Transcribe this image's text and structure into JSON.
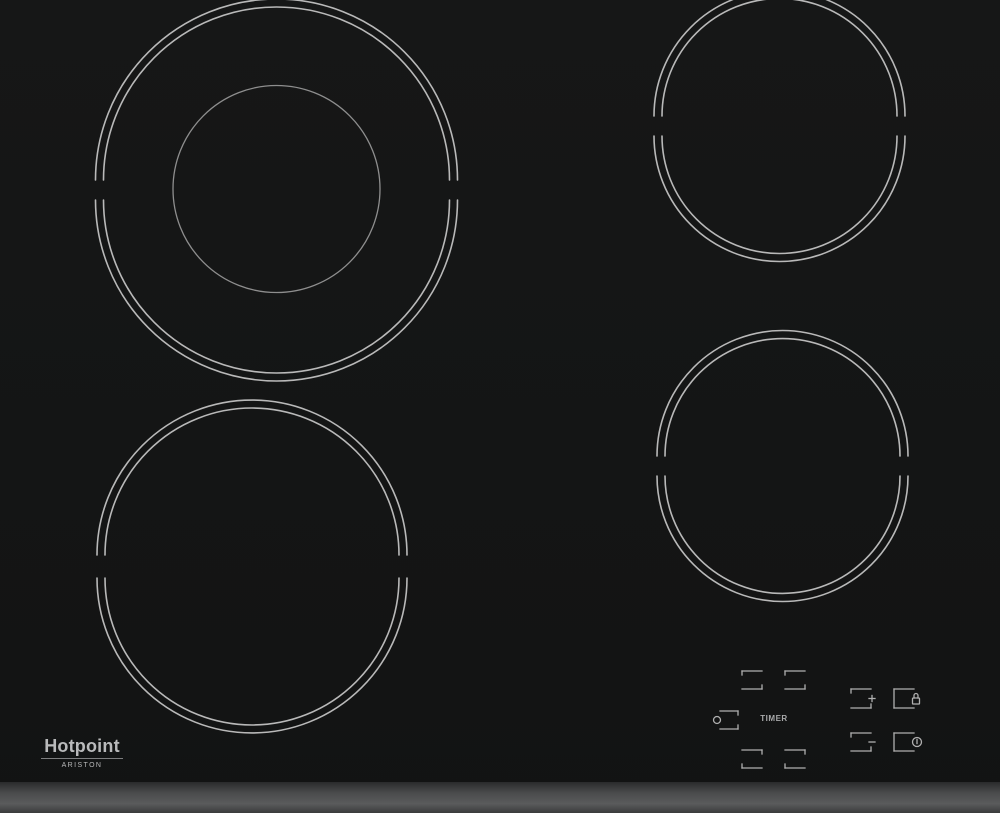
{
  "brand": {
    "name": "Hotpoint",
    "sub": "ARISTON"
  },
  "controls": {
    "timer_label": "TIMER"
  },
  "colors": {
    "glass": "#141515",
    "ring": "#b9b9b9",
    "inner_ring": "#8e8e8e",
    "control_marks": "#b0b0b0"
  },
  "icons": {
    "lock": "lock-icon",
    "power": "power-icon",
    "plus": "plus-icon",
    "minus": "minus-icon",
    "timer_dot": "timer-dot-icon"
  }
}
